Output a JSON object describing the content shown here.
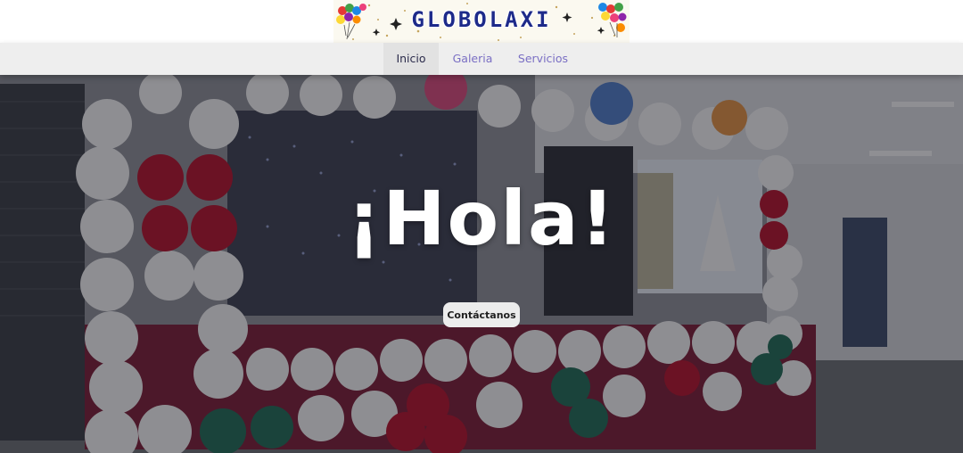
{
  "brand": {
    "logo_text": "GLOBOLAXI",
    "logo_icon": "balloon-cluster-icon"
  },
  "nav": {
    "items": [
      {
        "label": "Inicio",
        "active": true
      },
      {
        "label": "Galeria",
        "active": false
      },
      {
        "label": "Servicios",
        "active": false
      }
    ]
  },
  "hero": {
    "title": "¡Hola!",
    "cta_label": "Contáctanos",
    "background": "balloon-arch-photo"
  },
  "colors": {
    "nav_bg": "#eeeeee",
    "nav_link": "#7a6fc4",
    "nav_active_text": "#2b2b4b",
    "logo_text": "#1d2a8a",
    "balloon_white": "#f2f2f2",
    "balloon_red": "#c8102e",
    "balloon_green": "#1f6b55"
  }
}
